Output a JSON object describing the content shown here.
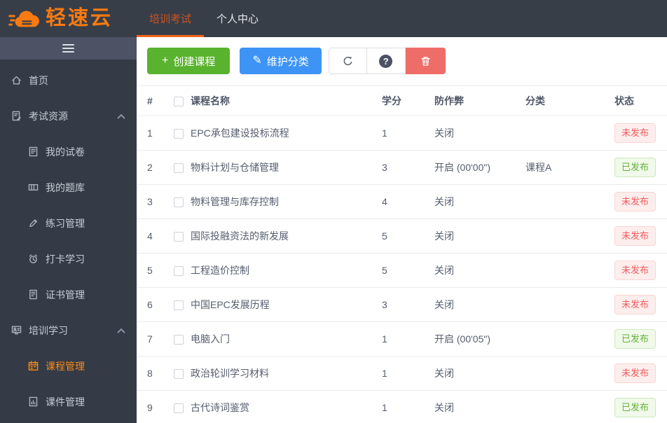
{
  "header": {
    "brand": "轻速云",
    "tabs": [
      {
        "label": "培训考试",
        "active": true
      },
      {
        "label": "个人中心",
        "active": false
      }
    ]
  },
  "sidebar": {
    "toggle_icon": "hamburger-icon",
    "items": [
      {
        "key": "home",
        "label": "首页",
        "type": "top",
        "icon": "home-icon"
      },
      {
        "key": "exam-resources",
        "label": "考试资源",
        "type": "group",
        "icon": "exam-resources-icon",
        "arrow": "chevron-up-icon"
      },
      {
        "key": "my-papers",
        "label": "我的试卷",
        "type": "sub",
        "icon": "my-papers-icon"
      },
      {
        "key": "my-question-bank",
        "label": "我的题库",
        "type": "sub",
        "icon": "question-bank-icon"
      },
      {
        "key": "practice-management",
        "label": "练习管理",
        "type": "sub",
        "icon": "practice-pencil-icon"
      },
      {
        "key": "checkin-learning",
        "label": "打卡学习",
        "type": "sub",
        "icon": "alarm-clock-icon"
      },
      {
        "key": "certificate-management",
        "label": "证书管理",
        "type": "sub",
        "icon": "certificate-icon"
      },
      {
        "key": "training-learning",
        "label": "培训学习",
        "type": "group",
        "icon": "training-icon",
        "arrow": "chevron-up-icon"
      },
      {
        "key": "course-management",
        "label": "课程管理",
        "type": "sub",
        "icon": "calendar-icon",
        "active": true
      },
      {
        "key": "courseware-management",
        "label": "课件管理",
        "type": "sub",
        "icon": "courseware-icon"
      }
    ]
  },
  "toolbar": {
    "create_label": "创建课程",
    "create_icon": "plus-icon",
    "maintain_label": "维护分类",
    "maintain_icon": "pencil-icon",
    "refresh_icon": "refresh-icon",
    "help_icon": "help-icon",
    "delete_icon": "trash-icon"
  },
  "table": {
    "columns": [
      "#",
      "课程名称",
      "学分",
      "防作弊",
      "分类",
      "状态"
    ],
    "rows": [
      {
        "num": "1",
        "name": "EPC承包建设投标流程",
        "credits": "1",
        "anticheat": "关闭",
        "category": "",
        "status": "未发布",
        "status_type": "unpublished"
      },
      {
        "num": "2",
        "name": "物料计划与仓储管理",
        "credits": "3",
        "anticheat": "开启 (00'00\")",
        "category": "课程A",
        "status": "已发布",
        "status_type": "published"
      },
      {
        "num": "3",
        "name": "物料管理与库存控制",
        "credits": "4",
        "anticheat": "关闭",
        "category": "",
        "status": "未发布",
        "status_type": "unpublished"
      },
      {
        "num": "4",
        "name": "国际投融资法的新发展",
        "credits": "5",
        "anticheat": "关闭",
        "category": "",
        "status": "未发布",
        "status_type": "unpublished"
      },
      {
        "num": "5",
        "name": "工程造价控制",
        "credits": "5",
        "anticheat": "关闭",
        "category": "",
        "status": "未发布",
        "status_type": "unpublished"
      },
      {
        "num": "6",
        "name": "中国EPC发展历程",
        "credits": "3",
        "anticheat": "关闭",
        "category": "",
        "status": "未发布",
        "status_type": "unpublished"
      },
      {
        "num": "7",
        "name": "电脑入门",
        "credits": "1",
        "anticheat": "开启 (00'05\")",
        "category": "",
        "status": "已发布",
        "status_type": "published"
      },
      {
        "num": "8",
        "name": "政治轮训学习材料",
        "credits": "1",
        "anticheat": "关闭",
        "category": "",
        "status": "未发布",
        "status_type": "unpublished"
      },
      {
        "num": "9",
        "name": "古代诗词鉴赏",
        "credits": "1",
        "anticheat": "关闭",
        "category": "",
        "status": "已发布",
        "status_type": "published"
      }
    ]
  },
  "colors": {
    "brand_orange": "#f87a10",
    "active_tab_text": "#cc5420",
    "active_tab_underline": "#f2641c",
    "header_bg": "#383e48",
    "sidebar_bg": "#353b46",
    "create_button_green": "#5ab32e",
    "maintain_button_blue": "#3d94f5",
    "delete_button_red": "#ee6d68",
    "published_green": "#64b13c",
    "unpublished_red": "#f15b5b"
  }
}
